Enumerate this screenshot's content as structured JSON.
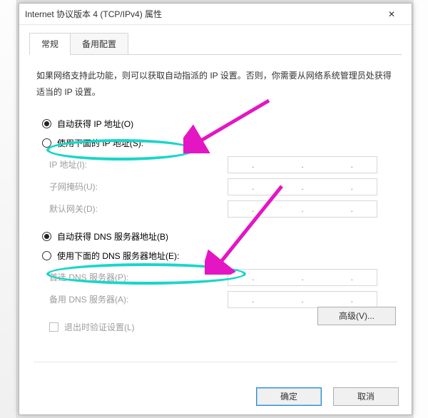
{
  "window": {
    "title": "Internet 协议版本 4 (TCP/IPv4) 属性",
    "close_glyph": "✕"
  },
  "tabs": {
    "general": "常规",
    "alternate": "备用配置"
  },
  "description": "如果网络支持此功能，则可以获取自动指派的 IP 设置。否则，你需要从网络系统管理员处获得适当的 IP 设置。",
  "ip": {
    "auto_label": "自动获得 IP 地址(O)",
    "manual_label": "使用下面的 IP 地址(S):",
    "fields": {
      "ip_address": "IP 地址(I):",
      "subnet": "子网掩码(U):",
      "gateway": "默认网关(D):"
    }
  },
  "dns": {
    "auto_label": "自动获得 DNS 服务器地址(B)",
    "manual_label": "使用下面的 DNS 服务器地址(E):",
    "fields": {
      "preferred": "首选 DNS 服务器(P):",
      "alternate": "备用 DNS 服务器(A):"
    }
  },
  "validate_label": "退出时验证设置(L)",
  "advanced_label": "高级(V)...",
  "buttons": {
    "ok": "确定",
    "cancel": "取消"
  },
  "annotations": {
    "arrow_color": "#e416c3",
    "oval_color": "#19d6c8"
  }
}
